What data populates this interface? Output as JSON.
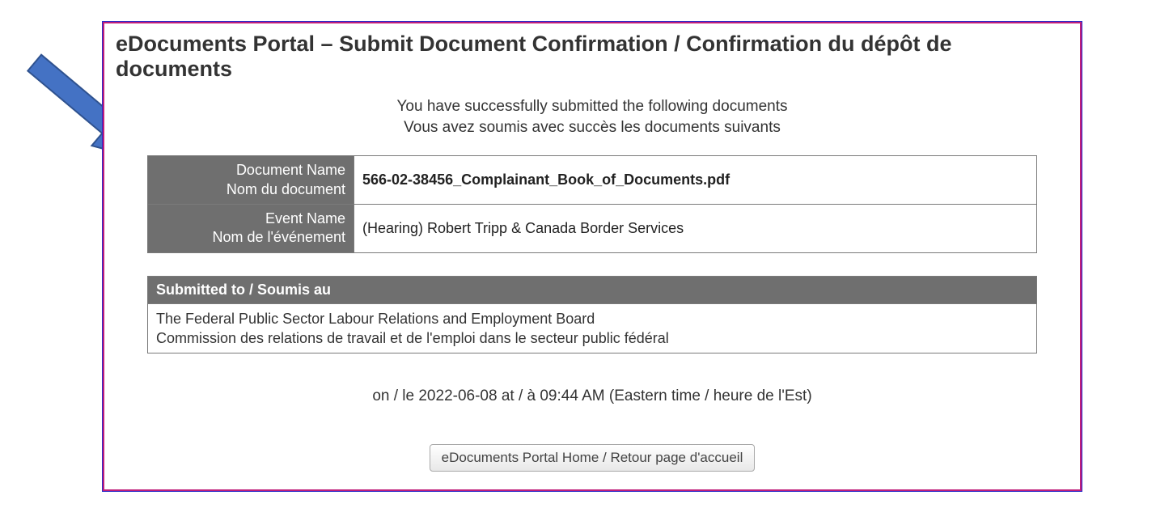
{
  "page": {
    "title": "eDocuments Portal – Submit Document Confirmation / Confirmation du dépôt de documents",
    "success_en": "You have successfully submitted the following documents",
    "success_fr": "Vous avez soumis avec succès les documents suivants",
    "timestamp": "on / le 2022-06-08 at / à 09:44 AM (Eastern time / heure de l'Est)",
    "home_button": "eDocuments Portal Home / Retour page d'accueil"
  },
  "labels": {
    "doc_name_en": "Document Name",
    "doc_name_fr": "Nom du document",
    "event_name_en": "Event Name",
    "event_name_fr": "Nom de l'événement",
    "submitted_to": "Submitted to / Soumis au"
  },
  "values": {
    "document_name": "566-02-38456_Complainant_Book_of_Documents.pdf",
    "event_name": "(Hearing) Robert Tripp & Canada Border Services",
    "submitted_to_en": "The Federal Public Sector Labour Relations and Employment Board",
    "submitted_to_fr": "Commission des relations de travail et de l'emploi dans le secteur public fédéral"
  }
}
